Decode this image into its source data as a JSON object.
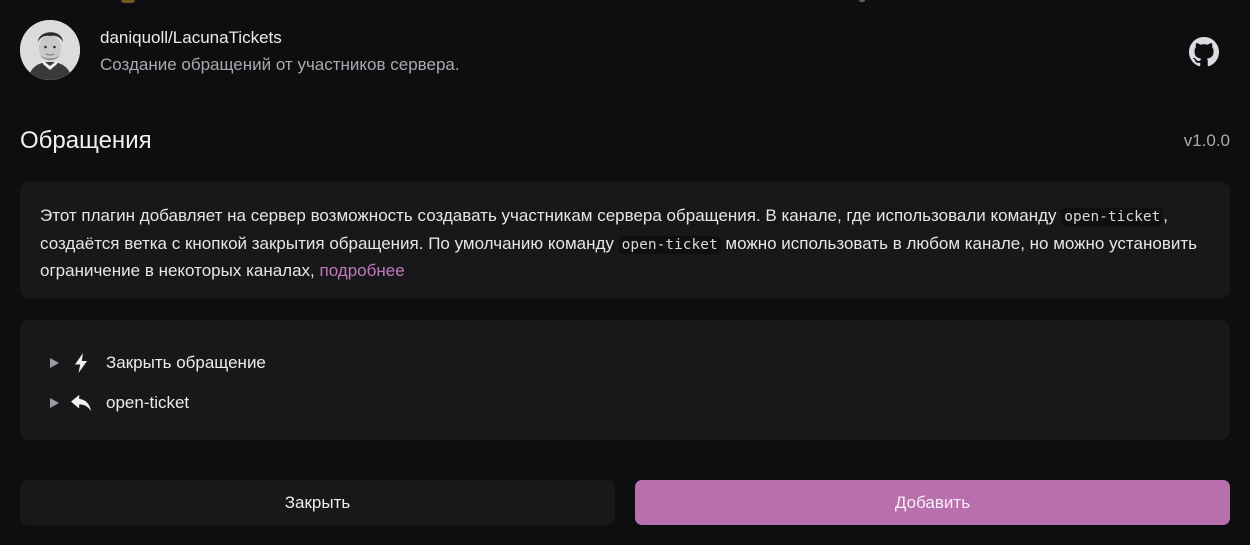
{
  "header": {
    "repo_name": "daniquoll/LacunaTickets",
    "description": "Создание обращений от участников сервера.",
    "avatar_icon": "user-avatar",
    "github_icon": "github-icon"
  },
  "section": {
    "title": "Обращения",
    "version": "v1.0.0"
  },
  "description": {
    "part1": "Этот плагин добавляет на сервер возможность создавать участникам сервера обращения. В канале, где использовали команду ",
    "code1": "open-ticket",
    "part2": ", создаётся ветка с кнопкой закрытия обращения. По умолчанию команду ",
    "code2": "open-ticket",
    "part3": " можно использовать в любом канале, но можно установить ограничение в некоторых каналах, ",
    "link": "подробнее"
  },
  "commands": [
    {
      "label": "Закрыть обращение",
      "icon": "lightning-icon"
    },
    {
      "label": "open-ticket",
      "icon": "reply-icon"
    }
  ],
  "actions": {
    "close_label": "Закрыть",
    "add_label": "Добавить"
  },
  "colors": {
    "background": "#0e0e10",
    "card": "#18181b",
    "accent": "#b86fae",
    "link": "#c07aba"
  }
}
